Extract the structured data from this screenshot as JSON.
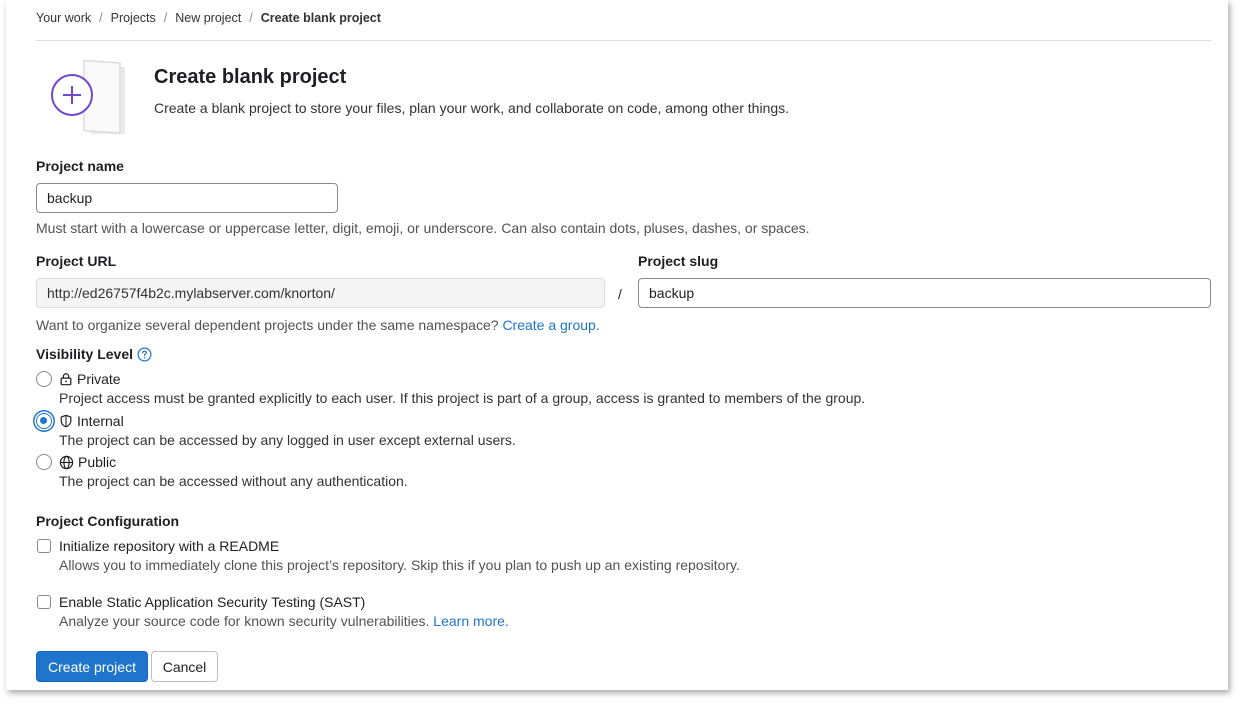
{
  "breadcrumb": {
    "items": [
      "Your work",
      "Projects",
      "New project"
    ],
    "current": "Create blank project",
    "separator": "/"
  },
  "header": {
    "title": "Create blank project",
    "description": "Create a blank project to store your files, plan your work, and collaborate on code, among other things."
  },
  "project_name": {
    "label": "Project name",
    "value": "backup",
    "help": "Must start with a lowercase or uppercase letter, digit, emoji, or underscore. Can also contain dots, pluses, dashes, or spaces."
  },
  "project_url": {
    "label": "Project URL",
    "value": "http://ed26757f4b2c.mylabserver.com/knorton/",
    "separator": "/"
  },
  "project_slug": {
    "label": "Project slug",
    "value": "backup"
  },
  "namespace_help": {
    "text": "Want to organize several dependent projects under the same namespace?",
    "link": "Create a group."
  },
  "visibility": {
    "label": "Visibility Level",
    "selected": "Internal",
    "options": [
      {
        "label": "Private",
        "icon": "lock-icon",
        "description": "Project access must be granted explicitly to each user. If this project is part of a group, access is granted to members of the group."
      },
      {
        "label": "Internal",
        "icon": "shield-icon",
        "description": "The project can be accessed by any logged in user except external users."
      },
      {
        "label": "Public",
        "icon": "globe-icon",
        "description": "The project can be accessed without any authentication."
      }
    ]
  },
  "config": {
    "label": "Project Configuration",
    "readme": {
      "label": "Initialize repository with a README",
      "description": "Allows you to immediately clone this project’s repository. Skip this if you plan to push up an existing repository.",
      "checked": false
    },
    "sast": {
      "label": "Enable Static Application Security Testing (SAST)",
      "description": "Analyze your source code for known security vulnerabilities.",
      "link": "Learn more.",
      "checked": false
    }
  },
  "actions": {
    "create": "Create project",
    "cancel": "Cancel"
  },
  "colors": {
    "accent": "#1f75cb",
    "icon_purple": "#6e49cb"
  }
}
